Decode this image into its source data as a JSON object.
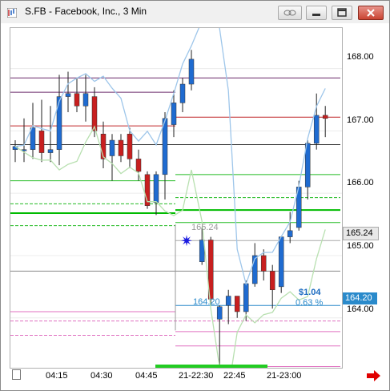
{
  "window": {
    "title": "S.FB - Facebook, Inc., 3 Min",
    "buttons": [
      "link-icon",
      "minimize-icon",
      "restore-icon",
      "close-icon"
    ]
  },
  "chart_data": {
    "type": "candlestick",
    "symbol": "S.FB",
    "interval": "3 Min",
    "y_ticks": [
      "168.00",
      "167.00",
      "166.00",
      "165.00",
      "164.00"
    ],
    "ylim": [
      163.2,
      168.65
    ],
    "x_ticks": [
      "04:15",
      "04:30",
      "04:45",
      "21-22:30",
      "22:45",
      "21-23:00"
    ],
    "current_price": "165.24",
    "alert_price": "164.20",
    "change_dollar": "$1.04",
    "change_percent": "0.63 %",
    "marker_price_label": "165.24",
    "low_price_label": "164.20",
    "candles": [
      {
        "o": 166.7,
        "h": 166.85,
        "l": 166.5,
        "c": 166.75,
        "dir": "up"
      },
      {
        "o": 166.7,
        "h": 167.2,
        "l": 166.5,
        "c": 166.68,
        "dir": "up"
      },
      {
        "o": 166.7,
        "h": 167.45,
        "l": 166.55,
        "c": 167.05,
        "dir": "up"
      },
      {
        "o": 167.0,
        "h": 167.5,
        "l": 166.5,
        "c": 166.65,
        "dir": "down"
      },
      {
        "o": 166.65,
        "h": 167.4,
        "l": 166.5,
        "c": 166.7,
        "dir": "up"
      },
      {
        "o": 166.7,
        "h": 167.9,
        "l": 166.45,
        "c": 167.55,
        "dir": "up"
      },
      {
        "o": 167.55,
        "h": 167.95,
        "l": 167.3,
        "c": 167.6,
        "dir": "up"
      },
      {
        "o": 167.6,
        "h": 167.85,
        "l": 167.3,
        "c": 167.4,
        "dir": "down"
      },
      {
        "o": 167.4,
        "h": 167.9,
        "l": 167.15,
        "c": 167.6,
        "dir": "up"
      },
      {
        "o": 167.55,
        "h": 167.7,
        "l": 166.9,
        "c": 167.0,
        "dir": "down"
      },
      {
        "o": 166.95,
        "h": 167.15,
        "l": 166.4,
        "c": 166.55,
        "dir": "down"
      },
      {
        "o": 166.6,
        "h": 166.95,
        "l": 166.2,
        "c": 166.85,
        "dir": "up"
      },
      {
        "o": 166.85,
        "h": 166.95,
        "l": 166.5,
        "c": 166.6,
        "dir": "down"
      },
      {
        "o": 166.95,
        "h": 167.05,
        "l": 166.4,
        "c": 166.55,
        "dir": "down"
      },
      {
        "o": 166.55,
        "h": 166.7,
        "l": 166.2,
        "c": 166.35,
        "dir": "down"
      },
      {
        "o": 166.3,
        "h": 166.35,
        "l": 165.75,
        "c": 165.8,
        "dir": "down"
      },
      {
        "o": 165.85,
        "h": 166.35,
        "l": 165.65,
        "c": 166.3,
        "dir": "up"
      },
      {
        "o": 166.3,
        "h": 167.3,
        "l": 165.9,
        "c": 167.2,
        "dir": "up"
      },
      {
        "o": 167.1,
        "h": 167.65,
        "l": 166.9,
        "c": 167.45,
        "dir": "up"
      },
      {
        "o": 167.45,
        "h": 167.85,
        "l": 167.3,
        "c": 167.75,
        "dir": "up"
      },
      {
        "o": 167.75,
        "h": 168.3,
        "l": 167.65,
        "c": 168.15,
        "dir": "up"
      },
      {
        "o": 164.9,
        "h": 165.45,
        "l": 164.85,
        "c": 165.25,
        "dir": "up"
      },
      {
        "o": 165.25,
        "h": 165.3,
        "l": 164.2,
        "c": 164.3,
        "dir": "down"
      },
      {
        "o": 163.98,
        "h": 164.2,
        "l": 163.25,
        "c": 164.18,
        "dir": "up"
      },
      {
        "o": 164.2,
        "h": 164.45,
        "l": 163.9,
        "c": 164.35,
        "dir": "up"
      },
      {
        "o": 164.35,
        "h": 164.35,
        "l": 164.0,
        "c": 164.1,
        "dir": "down"
      },
      {
        "o": 164.1,
        "h": 164.6,
        "l": 163.95,
        "c": 164.55,
        "dir": "up"
      },
      {
        "o": 164.55,
        "h": 165.2,
        "l": 164.5,
        "c": 165.0,
        "dir": "up"
      },
      {
        "o": 165.0,
        "h": 165.1,
        "l": 164.6,
        "c": 164.75,
        "dir": "down"
      },
      {
        "o": 164.75,
        "h": 164.85,
        "l": 164.15,
        "c": 164.45,
        "dir": "down"
      },
      {
        "o": 164.5,
        "h": 165.3,
        "l": 164.4,
        "c": 165.3,
        "dir": "up"
      },
      {
        "o": 165.3,
        "h": 165.7,
        "l": 165.2,
        "c": 165.4,
        "dir": "up"
      },
      {
        "o": 165.45,
        "h": 166.2,
        "l": 165.4,
        "c": 166.1,
        "dir": "up"
      },
      {
        "o": 166.1,
        "h": 166.85,
        "l": 165.9,
        "c": 166.8,
        "dir": "up"
      },
      {
        "o": 166.8,
        "h": 167.6,
        "l": 166.7,
        "c": 167.25,
        "dir": "up"
      },
      {
        "o": 167.25,
        "h": 167.4,
        "l": 166.9,
        "c": 167.2,
        "dir": "down"
      }
    ],
    "levels": [
      {
        "price": 167.85,
        "color": "#6b2a6b",
        "from": 0,
        "to": 1
      },
      {
        "price": 167.62,
        "color": "#6b2a6b",
        "from": 0,
        "to": 0.5
      },
      {
        "price": 167.22,
        "color": "#c0282a",
        "from": 0.5,
        "to": 1
      },
      {
        "price": 167.08,
        "color": "#c0282a",
        "from": 0,
        "to": 0.5
      },
      {
        "price": 166.78,
        "color": "#333333",
        "from": 0,
        "to": 1
      },
      {
        "price": 166.3,
        "color": "#22bb22",
        "from": 0.5,
        "to": 1
      },
      {
        "price": 166.2,
        "color": "#22bb22",
        "from": 0,
        "to": 0.5
      },
      {
        "price": 165.93,
        "color": "#22bb22",
        "from": 0.5,
        "to": 1,
        "dash": true
      },
      {
        "price": 165.83,
        "color": "#22bb22",
        "from": 0,
        "to": 0.5,
        "dash": true
      },
      {
        "price": 165.73,
        "color": "#00bb00",
        "from": 0.5,
        "to": 1,
        "width": 2
      },
      {
        "price": 165.68,
        "color": "#00bb00",
        "from": 0,
        "to": 0.5,
        "width": 2
      },
      {
        "price": 165.53,
        "color": "#22bb22",
        "from": 0.5,
        "to": 1
      },
      {
        "price": 165.48,
        "color": "#22bb22",
        "from": 0,
        "to": 0.5,
        "dash": true
      },
      {
        "price": 165.24,
        "color": "#aaaaaa",
        "from": 0.5,
        "to": 1
      },
      {
        "price": 164.75,
        "color": "#888888",
        "from": 0,
        "to": 1
      },
      {
        "price": 164.2,
        "color": "#2a8acb",
        "from": 0.5,
        "to": 1
      },
      {
        "price": 164.1,
        "color": "#e070c0",
        "from": 0,
        "to": 0.5
      },
      {
        "price": 163.95,
        "color": "#e070c0",
        "from": 0,
        "to": 1,
        "dash": true
      },
      {
        "price": 163.78,
        "color": "#e070c0",
        "from": 0.5,
        "to": 1
      },
      {
        "price": 163.72,
        "color": "#e070c0",
        "from": 0,
        "to": 0.5,
        "dash": true
      },
      {
        "price": 163.55,
        "color": "#e070c0",
        "from": 0.5,
        "to": 1
      },
      {
        "price": 163.22,
        "color": "#e070c0",
        "from": 0.5,
        "to": 1
      }
    ]
  }
}
